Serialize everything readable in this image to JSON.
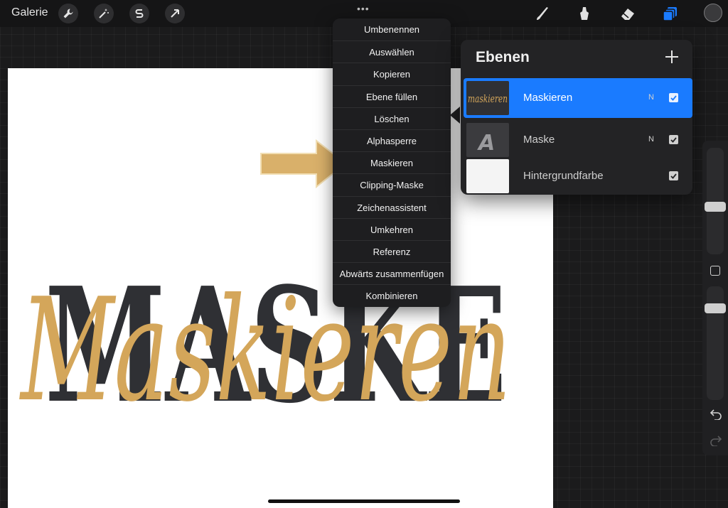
{
  "toolbar": {
    "gallery_label": "Galerie",
    "tools_left": [
      "wrench-icon",
      "magic-wand-icon",
      "selection-s-icon",
      "arrow-transform-icon"
    ],
    "tools_right": [
      "brush-icon",
      "smudge-icon",
      "eraser-icon",
      "layers-icon"
    ],
    "more_dots": "•••",
    "active_tool_color": "#1a7bff"
  },
  "canvas": {
    "background_text": "MASKE",
    "script_text": "Maskieren",
    "script_color": "#d4a65a",
    "block_color": "#2f3034"
  },
  "context_menu": {
    "items": [
      "Umbenennen",
      "Auswählen",
      "Kopieren",
      "Ebene füllen",
      "Löschen",
      "Alphasperre",
      "Maskieren",
      "Clipping-Maske",
      "Zeichenassistent",
      "Umkehren",
      "Referenz",
      "Abwärts zusammenfügen",
      "Kombinieren"
    ],
    "highlighted_item": "Maskieren"
  },
  "layers_panel": {
    "title": "Ebenen",
    "add_icon": "plus-icon",
    "layers": [
      {
        "name": "Maskieren",
        "mode": "N",
        "visible": true,
        "active": true,
        "thumb_text": "maskieren"
      },
      {
        "name": "Maske",
        "mode": "N",
        "visible": true,
        "active": false,
        "thumb_text": "A"
      },
      {
        "name": "Hintergrundfarbe",
        "mode": "",
        "visible": true,
        "active": false,
        "thumb_text": ""
      }
    ]
  },
  "sidebar": {
    "brush_size_level": 0.45,
    "opacity_level": 0.85
  },
  "colors": {
    "accent": "#1a7bff",
    "arrow": "#d9b06a",
    "menu_bg": "#1e1e20",
    "panel_bg": "#232325"
  }
}
